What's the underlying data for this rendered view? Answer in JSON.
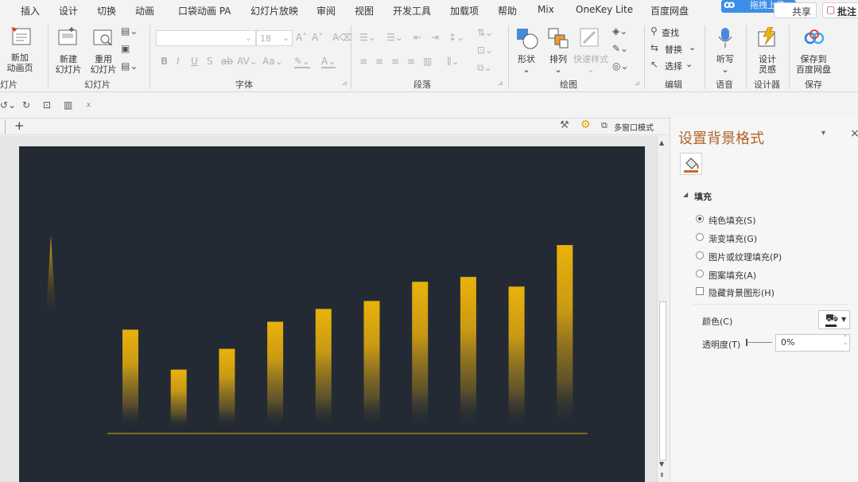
{
  "menu": [
    "插入",
    "设计",
    "切换",
    "动画",
    "口袋动画 PA",
    "幻灯片放映",
    "审阅",
    "视图",
    "开发工具",
    "加载项",
    "帮助",
    "Mix",
    "OneKey Lite",
    "百度网盘"
  ],
  "top_right": {
    "upload": "拖拽上传",
    "share": "共享",
    "comment": "批注"
  },
  "ribbon": {
    "new_anim_page": [
      "新加",
      "动画页"
    ],
    "new_slide": [
      "新建",
      "幻灯片"
    ],
    "reuse_slide": [
      "重用",
      "幻灯片"
    ],
    "group_slides": "幻灯片",
    "font_size": "18",
    "group_font": "字体",
    "group_paragraph": "段落",
    "shape": "形状",
    "arrange": "排列",
    "quick_style": "快速样式",
    "group_drawing": "绘图",
    "find": "查找",
    "replace": "替换",
    "select": "选择",
    "group_edit": "编辑",
    "dictate": "听写",
    "group_voice": "语音",
    "design_ideas": [
      "设计",
      "灵感"
    ],
    "group_designer": "设计器",
    "save_baidu": [
      "保存到",
      "百度网盘"
    ],
    "group_save": "保存",
    "left_fragment": "灯片"
  },
  "tabbar": {
    "multi_window": "多窗口模式"
  },
  "pane": {
    "title": "设置背景格式",
    "section": "填充",
    "options": [
      "纯色填充(S)",
      "渐变填充(G)",
      "图片或纹理填充(P)",
      "图案填充(A)"
    ],
    "selected_option": 0,
    "hide_bg": "隐藏背景图形(H)",
    "color_label": "颜色(C)",
    "transparency_label": "透明度(T)",
    "transparency_value": "0%"
  },
  "chart_data": {
    "type": "bar",
    "values": [
      62,
      37,
      50,
      67,
      75,
      80,
      92,
      95,
      89,
      115
    ],
    "ylim": [
      0,
      125
    ],
    "bar_color": "#e8b00c",
    "background": "#232a33",
    "baseline_color": "#d9a514"
  }
}
